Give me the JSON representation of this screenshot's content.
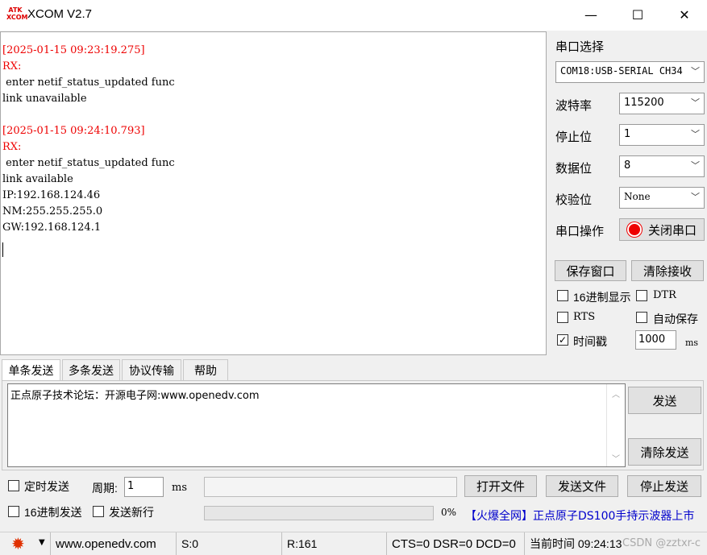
{
  "window": {
    "title": "XCOM V2.7",
    "icon_text": "ATK\nXCOM",
    "minimize_glyph": "—",
    "maximize_glyph": "☐",
    "close_glyph": "✕"
  },
  "receive": {
    "lines": [
      {
        "text": "[2025-01-15 09:23:19.275]",
        "color": "red"
      },
      {
        "text": "RX:",
        "color": "red"
      },
      {
        "text": " enter netif_status_updated func",
        "color": "black"
      },
      {
        "text": "link unavailable",
        "color": "black"
      },
      {
        "text": "",
        "color": "black"
      },
      {
        "text": "[2025-01-15 09:24:10.793]",
        "color": "red"
      },
      {
        "text": "RX:",
        "color": "red"
      },
      {
        "text": " enter netif_status_updated func",
        "color": "black"
      },
      {
        "text": "link available",
        "color": "black"
      },
      {
        "text": "IP:192.168.124.46",
        "color": "black"
      },
      {
        "text": "NM:255.255.255.0",
        "color": "black"
      },
      {
        "text": "GW:192.168.124.1",
        "color": "black"
      }
    ]
  },
  "settings": {
    "port_label": "串口选择",
    "port_value": "COM18:USB-SERIAL CH34",
    "baud_label": "波特率",
    "baud_value": "115200",
    "stop_label": "停止位",
    "stop_value": "1",
    "data_label": "数据位",
    "data_value": "8",
    "parity_label": "校验位",
    "parity_value": "None",
    "op_label": "串口操作",
    "op_button": "关闭串口",
    "save_window": "保存窗口",
    "clear_receive": "清除接收",
    "hex_display": "16进制显示",
    "dtr": "DTR",
    "rts": "RTS",
    "auto_save": "自动保存",
    "timestamp": "时间戳",
    "timestamp_checked": true,
    "interval_value": "1000",
    "interval_unit": "ms"
  },
  "tabs": [
    "单条发送",
    "多条发送",
    "协议传输",
    "帮助"
  ],
  "send": {
    "text": "正点原子技术论坛：开源电子网:www.openedv.com",
    "send_button": "发送",
    "clear_send_button": "清除发送",
    "timed_send": "定时发送",
    "period_label": "周期:",
    "period_value": "1",
    "period_unit": "ms",
    "open_file": "打开文件",
    "send_file": "发送文件",
    "stop_send": "停止发送",
    "hex_send": "16进制发送",
    "send_newline": "发送新行",
    "progress_text": "0%",
    "progress_value": 0,
    "ad_text": "【火爆全网】正点原子DS100手持示波器上市"
  },
  "statusbar": {
    "website": "www.openedv.com",
    "sent": "S:0",
    "received": "R:161",
    "signals": "CTS=0 DSR=0 DCD=0",
    "time": "当前时间 09:24:13",
    "watermark": "CSDN @zztxr-c"
  }
}
